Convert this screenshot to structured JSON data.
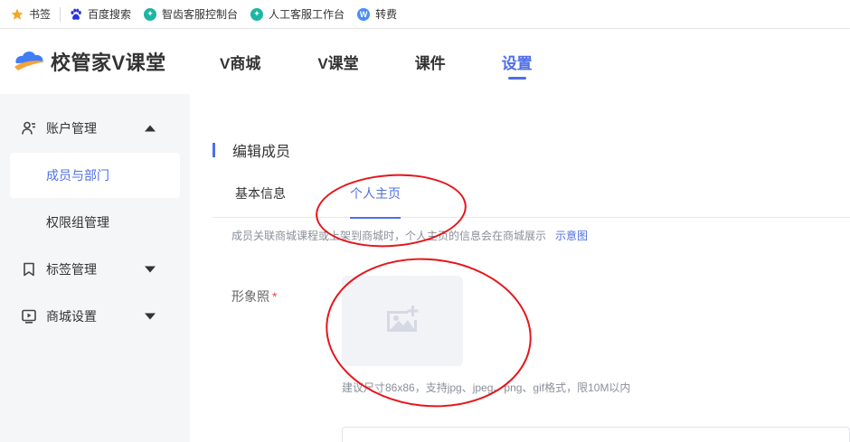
{
  "bookmarks": [
    {
      "label": "书签",
      "icon": "star-icon"
    },
    {
      "label": "百度搜索",
      "icon": "baidu-paw-icon"
    },
    {
      "label": "智齿客服控制台",
      "icon": "tooth-icon"
    },
    {
      "label": "人工客服工作台",
      "icon": "tooth-icon"
    },
    {
      "label": "转费",
      "icon": "w-logo-icon"
    }
  ],
  "brand": {
    "name": "校管家V课堂",
    "logo": "cloud-logo-icon",
    "colors": {
      "blue": "#3f7ef7",
      "orange": "#f7a23b"
    }
  },
  "nav": [
    {
      "label": "V商城",
      "active": false
    },
    {
      "label": "V课堂",
      "active": false
    },
    {
      "label": "课件",
      "active": false
    },
    {
      "label": "设置",
      "active": true
    }
  ],
  "sidebar": {
    "groups": [
      {
        "label": "账户管理",
        "icon": "user-manage-icon",
        "expanded": true,
        "items": [
          {
            "label": "成员与部门",
            "active": true
          },
          {
            "label": "权限组管理",
            "active": false
          }
        ]
      },
      {
        "label": "标签管理",
        "icon": "bookmark-icon",
        "expanded": false
      },
      {
        "label": "商城设置",
        "icon": "store-play-icon",
        "expanded": false
      }
    ]
  },
  "main": {
    "title": "编辑成员",
    "tabs": [
      {
        "label": "基本信息",
        "active": false
      },
      {
        "label": "个人主页",
        "active": true
      }
    ],
    "hint": "成员关联商城课程或上架到商城时，个人主页的信息会在商城展示",
    "hint_link": "示意图",
    "photo_label": "形象照",
    "required_mark": "*",
    "upload_icon": "add-image-icon",
    "upload_tip": "建议尺寸86x86，支持jpg、jpeg、png、gif格式，限10M以内"
  },
  "accent_color": "#4f6fe8",
  "annotation_color": "#e5161c"
}
